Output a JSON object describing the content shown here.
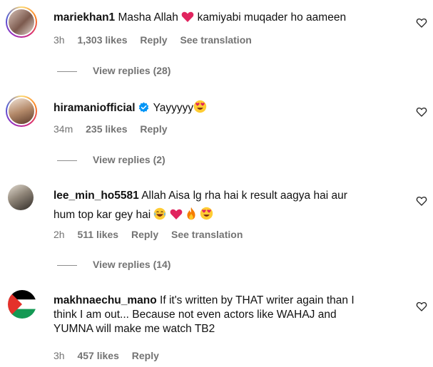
{
  "comments": [
    {
      "username": "mariekhan1",
      "text_before": "Masha Allah",
      "text_after": "kamiyabi muqader ho aameen",
      "time": "3h",
      "likes": "1,303 likes",
      "reply": "Reply",
      "translation": "See translation",
      "view_replies": "View replies (28)"
    },
    {
      "username": "hiramaniofficial",
      "text_before": "Yayyyyy",
      "time": "34m",
      "likes": "235 likes",
      "reply": "Reply",
      "view_replies": "View replies (2)"
    },
    {
      "username": "lee_min_ho5581",
      "line1": "Allah Aisa lg rha hai k result aagya hai aur",
      "line2": "hum top kar gey hai",
      "time": "2h",
      "likes": "511 likes",
      "reply": "Reply",
      "translation": "See translation",
      "view_replies": "View replies (14)"
    },
    {
      "username": "makhnaechu_mano",
      "line1": "If it's written by THAT writer again than I",
      "line2": "think I am out... Because not even actors like WAHAJ and",
      "line3": "YUMNA will make me watch TB2",
      "time": "3h",
      "likes": "457 likes",
      "reply": "Reply"
    }
  ],
  "icons": {
    "like": "heart-outline-icon",
    "verified": "verified-badge-icon"
  },
  "colors": {
    "meta": "#737373",
    "verified": "#0095f6",
    "heart_red": "#e0245e"
  }
}
